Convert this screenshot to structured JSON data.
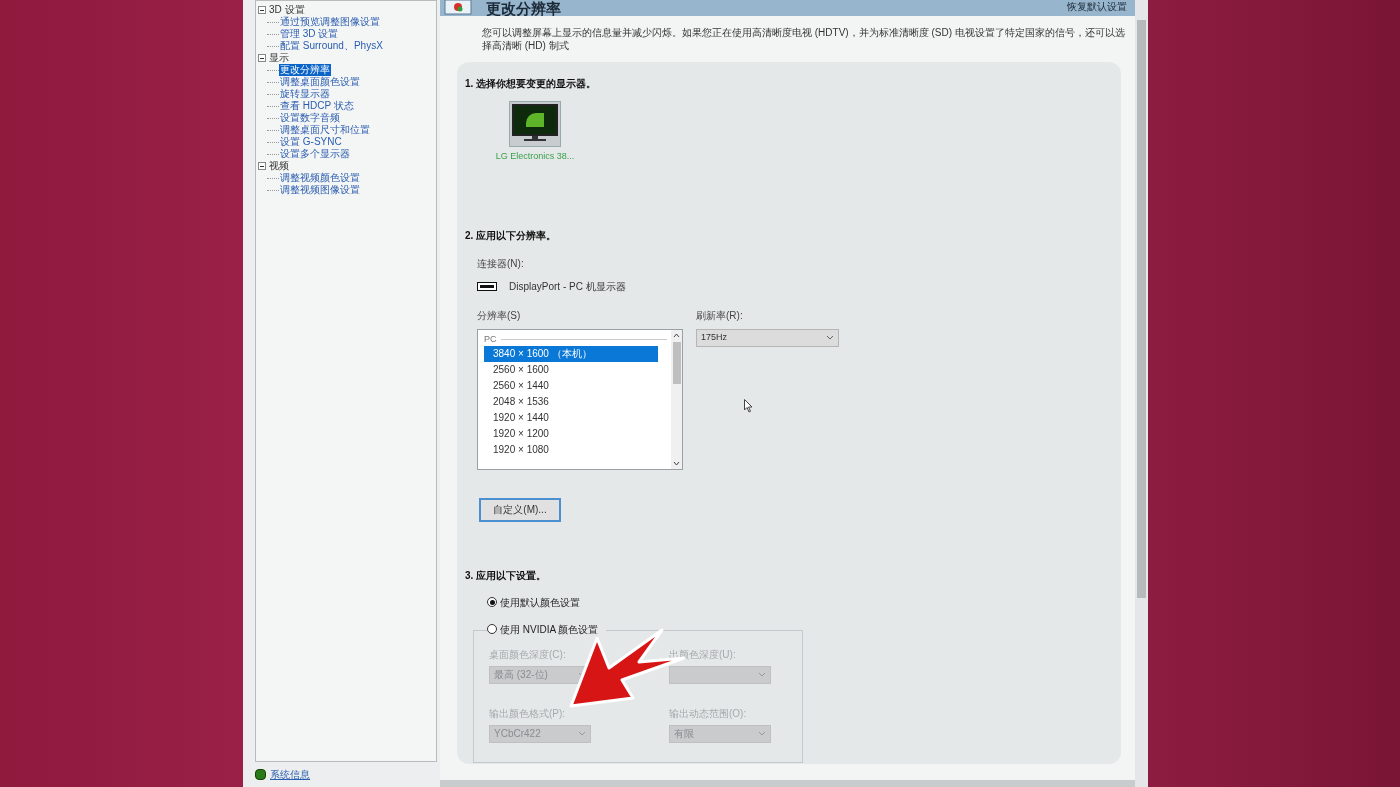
{
  "header": {
    "title": "更改分辨率",
    "restore_link": "恢复默认设置"
  },
  "sidebar": {
    "tree": [
      {
        "label": "3D 设置",
        "expanded": true,
        "children": [
          {
            "label": "通过预览调整图像设置",
            "selected": false
          },
          {
            "label": "管理 3D 设置",
            "selected": false
          },
          {
            "label": "配置 Surround、PhysX",
            "selected": false
          }
        ]
      },
      {
        "label": "显示",
        "expanded": true,
        "children": [
          {
            "label": "更改分辨率",
            "selected": true
          },
          {
            "label": "调整桌面颜色设置",
            "selected": false
          },
          {
            "label": "旋转显示器",
            "selected": false
          },
          {
            "label": "查看 HDCP 状态",
            "selected": false
          },
          {
            "label": "设置数字音频",
            "selected": false
          },
          {
            "label": "调整桌面尺寸和位置",
            "selected": false
          },
          {
            "label": "设置 G-SYNC",
            "selected": false
          },
          {
            "label": "设置多个显示器",
            "selected": false
          }
        ]
      },
      {
        "label": "视频",
        "expanded": true,
        "children": [
          {
            "label": "调整视频颜色设置",
            "selected": false
          },
          {
            "label": "调整视频图像设置",
            "selected": false
          }
        ]
      }
    ],
    "footer_link": "系统信息"
  },
  "description": "您可以调整屏幕上显示的信息量并减少闪烁。如果您正在使用高清晰度电视 (HDTV)，并为标准清晰度 (SD) 电视设置了特定国家的信号，还可以选择高清晰 (HD) 制式",
  "section1": {
    "heading": "1. 选择你想要变更的显示器。",
    "displays": [
      {
        "label": "LG Electronics 38...",
        "selected": true
      }
    ]
  },
  "section2": {
    "heading": "2. 应用以下分辨率。",
    "connector_label": "连接器(N):",
    "connector": "DisplayPort - PC 机显示器",
    "resolution_label": "分辨率(S)",
    "resolution_group": "PC",
    "resolutions": [
      {
        "label": "3840 × 1600 （本机）",
        "selected": true
      },
      {
        "label": "2560 × 1600",
        "selected": false
      },
      {
        "label": "2560 × 1440",
        "selected": false
      },
      {
        "label": "2048 × 1536",
        "selected": false
      },
      {
        "label": "1920 × 1440",
        "selected": false
      },
      {
        "label": "1920 × 1200",
        "selected": false
      },
      {
        "label": "1920 × 1080",
        "selected": false
      }
    ],
    "refresh_label": "刷新率(R):",
    "refresh_value": "175Hz",
    "custom_button": "自定义(M)..."
  },
  "section3": {
    "heading": "3. 应用以下设置。",
    "options": [
      {
        "label": "使用默认颜色设置",
        "selected": true
      },
      {
        "label": "使用 NVIDIA 颜色设置",
        "selected": false
      }
    ],
    "disabled": true,
    "fields": [
      {
        "label": "桌面颜色深度(C):",
        "value": "最高 (32-位)"
      },
      {
        "label": "出颜色深度(U):"
      },
      {
        "label": "输出颜色格式(P):",
        "value": "YCbCr422"
      },
      {
        "label": "输出动态范围(O):",
        "value": "有限"
      }
    ]
  }
}
